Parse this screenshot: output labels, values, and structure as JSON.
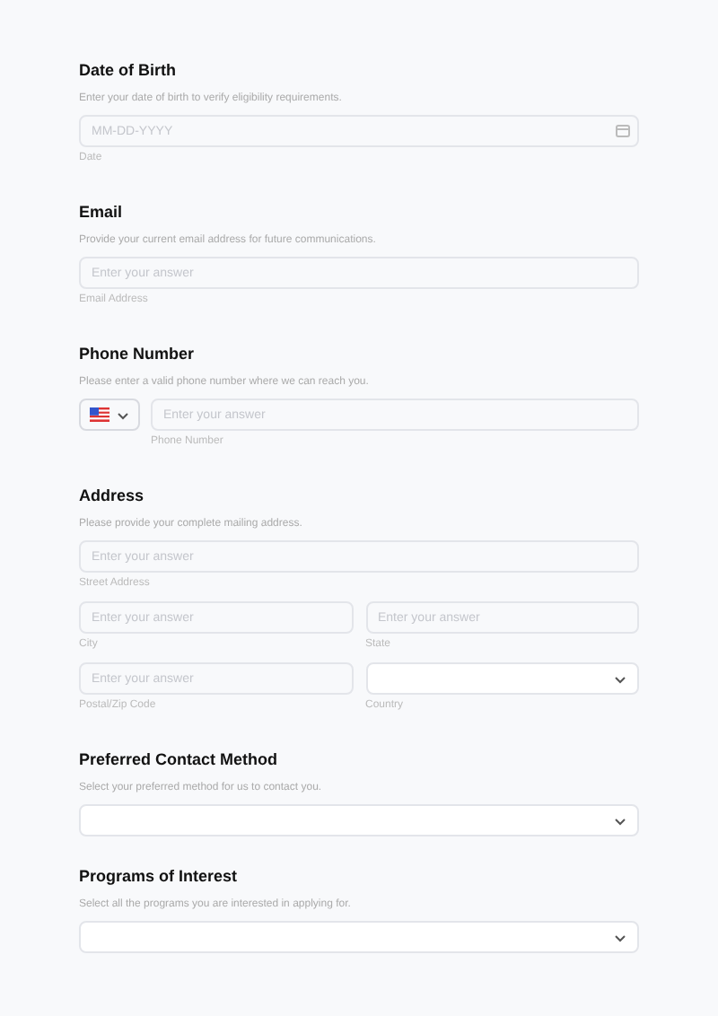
{
  "sections": [
    {
      "title": "Date of Birth",
      "description": "Enter your date of birth to verify eligibility requirements.",
      "rows": [
        [
          {
            "kind": "date",
            "placeholder": "MM-DD-YYYY",
            "label": "Date"
          }
        ]
      ]
    },
    {
      "title": "Email",
      "description": "Provide your current email address for future communications.",
      "rows": [
        [
          {
            "kind": "text",
            "placeholder": "Enter your answer",
            "label": "Email Address"
          }
        ]
      ]
    },
    {
      "title": "Phone Number",
      "description": "Please enter a valid phone number where we can reach you.",
      "rows": [
        [
          {
            "kind": "phone",
            "placeholder": "Enter your answer",
            "label": "Phone Number"
          }
        ]
      ]
    },
    {
      "title": "Address",
      "description": "Please provide your complete mailing address.",
      "rows": [
        [
          {
            "kind": "text",
            "placeholder": "Enter your answer",
            "label": "Street Address"
          }
        ],
        [
          {
            "kind": "text",
            "placeholder": "Enter your answer",
            "label": "City"
          },
          {
            "kind": "text",
            "placeholder": "Enter your answer",
            "label": "State"
          }
        ],
        [
          {
            "kind": "text",
            "placeholder": "Enter your answer",
            "label": "Postal/Zip Code"
          },
          {
            "kind": "select",
            "label": "Country"
          }
        ]
      ]
    },
    {
      "title": "Preferred Contact Method",
      "description": "Select your preferred method for us to contact you.",
      "rows": [
        [
          {
            "kind": "select"
          }
        ]
      ]
    },
    {
      "title": "Programs of Interest",
      "description": "Select all the programs you are interested in applying for.",
      "rows": [
        [
          {
            "kind": "select"
          }
        ]
      ]
    }
  ]
}
